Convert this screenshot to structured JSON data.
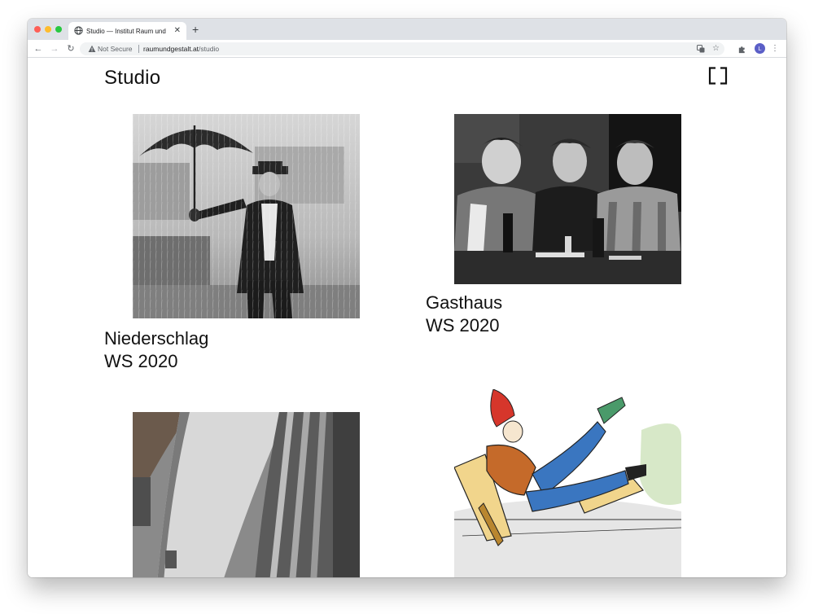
{
  "browser": {
    "tab_title": "Studio — Institut Raum und Ge",
    "tab_close": "✕",
    "new_tab": "+",
    "security_label": "Not Secure",
    "url_host": "raumundgestalt.at",
    "url_path": "/studio",
    "profile_initial": "L",
    "back": "←",
    "forward": "→",
    "reload": "↻",
    "star": "☆",
    "menu": "⋮",
    "icons": [
      "globe-icon",
      "warning-icon",
      "translate-icon",
      "star-icon",
      "puzzle-icon",
      "kebab-menu-icon"
    ]
  },
  "page": {
    "title": "Studio",
    "menu_icon": "bracket-menu-icon",
    "projects": [
      {
        "name": "Niederschlag",
        "term": "WS 2020",
        "image": "man-with-umbrella-in-rain"
      },
      {
        "name": "Gasthaus",
        "term": "WS 2020",
        "image": "men-at-table-in-tavern"
      },
      {
        "name": "",
        "term": "",
        "image": "concrete-dam-wall"
      },
      {
        "name": "",
        "term": "",
        "image": "illustrated-figure-falling"
      }
    ]
  },
  "colors": {
    "tabstrip": "#dee1e6",
    "omnibox": "#f1f3f4",
    "profile": "#5b5fc7",
    "text": "#111111"
  }
}
